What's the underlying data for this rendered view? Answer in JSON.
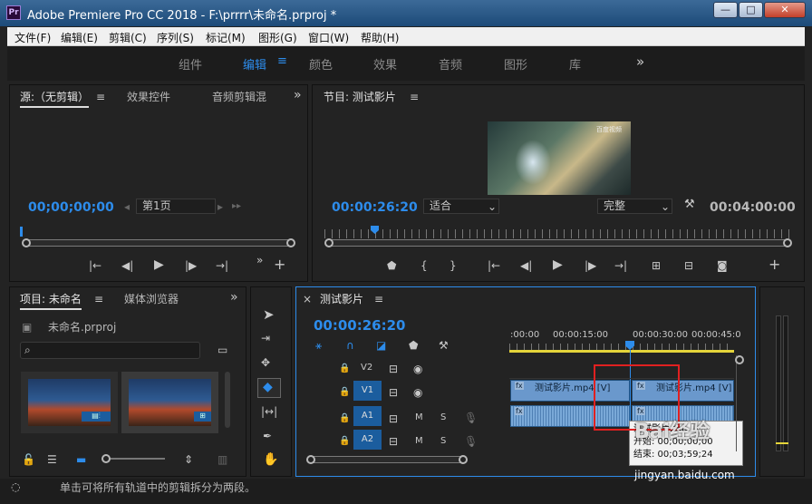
{
  "window": {
    "title": "Adobe Premiere Pro CC 2018 - F:\\prrrr\\未命名.prproj *",
    "app_icon": "Pr"
  },
  "window_buttons": [
    "—",
    "□",
    "✕"
  ],
  "menu": [
    "文件(F)",
    "编辑(E)",
    "剪辑(C)",
    "序列(S)",
    "标记(M)",
    "图形(G)",
    "窗口(W)",
    "帮助(H)"
  ],
  "workspaces": [
    "组件",
    "编辑",
    "颜色",
    "效果",
    "音频",
    "图形",
    "库"
  ],
  "workspace_more": "»",
  "source_panel": {
    "tabs": [
      "源:（无剪辑）",
      "效果控件",
      "音频剪辑混"
    ],
    "timecode": "00;00;00;00",
    "page_select": "第1页",
    "more": "»"
  },
  "program_panel": {
    "tab": "节目: 测试影片",
    "timecode": "00:00:26:20",
    "fit_select": "适合",
    "quality_select": "完整",
    "duration": "00:04:00:00",
    "thumbnail_logo": "百度视频"
  },
  "project_panel": {
    "tabs": [
      "项目: 未命名",
      "媒体浏览器"
    ],
    "file_name": "未命名.prproj",
    "more": "»"
  },
  "timeline": {
    "close": "×",
    "tab": "测试影片",
    "timecode": "00:00:26:20",
    "ruler_labels": [
      ":00:00",
      "00:00:15:00",
      "00:00:30:00",
      "00:00:45:0"
    ],
    "tracks": [
      {
        "id": "V2",
        "letter": ""
      },
      {
        "id": "V1",
        "letter": ""
      },
      {
        "id": "A1",
        "letter": "M"
      },
      {
        "id": "A2",
        "letter": "M"
      }
    ],
    "solo": "S",
    "clips": {
      "v1_a": "测试影片.mp4 [V]",
      "v1_b": "测试影片.mp4 [V]",
      "fx": "fx"
    },
    "tooltip": {
      "title": "测试影片.mp",
      "line2": "开始: 00;00;00;00",
      "line3": "结束: 00;03;59;24"
    }
  },
  "status_bar": "单击可将所有轨道中的剪辑拆分为两段。",
  "watermark": {
    "text": "Bai经验",
    "sub": "jingyan.baidu.com"
  },
  "icons": {
    "hamburger": "≡",
    "more": "»",
    "play": "▶",
    "step_back": "◀|",
    "step_forward": "|▶",
    "plus": "+",
    "wrench": "🔧",
    "search": "⌕",
    "folder": "▣"
  },
  "colors": {
    "accent": "#2d8ceb",
    "titlebar": "#1c4a78",
    "track_blue": "#1b5d9e",
    "clip": "#6a98cc",
    "highlight_box": "#e02020"
  }
}
